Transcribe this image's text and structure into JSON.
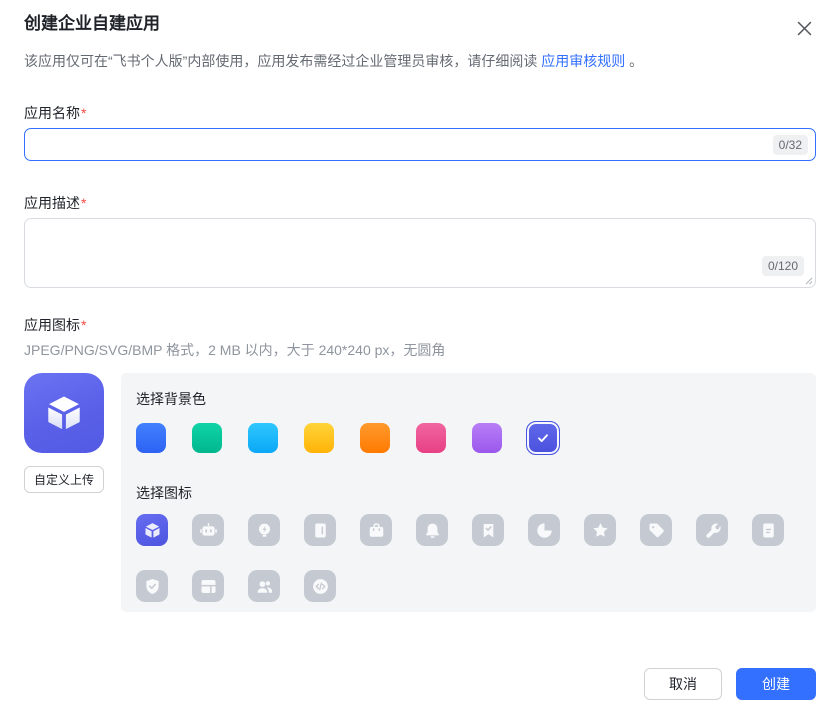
{
  "dialog": {
    "title": "创建企业自建应用",
    "subtitle_prefix": "该应用仅可在“飞书个人版”内部使用，应用发布需经过企业管理员审核，请仔细阅读",
    "subtitle_link": "应用审核规则",
    "subtitle_suffix": "。"
  },
  "fields": {
    "name": {
      "label": "应用名称",
      "required_mark": "*",
      "value": "",
      "placeholder": "",
      "counter": "0/32"
    },
    "description": {
      "label": "应用描述",
      "required_mark": "*",
      "value": "",
      "placeholder": "",
      "counter": "0/120"
    },
    "icon": {
      "label": "应用图标",
      "required_mark": "*",
      "hint": "JPEG/PNG/SVG/BMP 格式，2 MB 以内，大于 240*240 px，无圆角"
    }
  },
  "icon_section": {
    "upload_button": "自定义上传",
    "bg_color_title": "选择背景色",
    "icon_picker_title": "选择图标",
    "selected_icon": "cube",
    "colors": [
      {
        "name": "blue",
        "from": "#4181ff",
        "to": "#2d62f3",
        "selected": false
      },
      {
        "name": "teal",
        "from": "#11d3a7",
        "to": "#00b78e",
        "selected": false
      },
      {
        "name": "sky",
        "from": "#2fc7fe",
        "to": "#0aa8f7",
        "selected": false
      },
      {
        "name": "amber",
        "from": "#ffd43a",
        "to": "#ffb307",
        "selected": false
      },
      {
        "name": "orange",
        "from": "#ff9a2e",
        "to": "#ff7a00",
        "selected": false
      },
      {
        "name": "rose",
        "from": "#f1659f",
        "to": "#e74084",
        "selected": false
      },
      {
        "name": "violet",
        "from": "#b77ef7",
        "to": "#9b58ec",
        "selected": false
      },
      {
        "name": "indigo",
        "from": "#6169ea",
        "to": "#4a50dd",
        "selected": true
      }
    ],
    "icons": [
      {
        "name": "cube",
        "selected": true
      },
      {
        "name": "robot",
        "selected": false
      },
      {
        "name": "bulb",
        "selected": false
      },
      {
        "name": "book",
        "selected": false
      },
      {
        "name": "briefcase",
        "selected": false
      },
      {
        "name": "bell",
        "selected": false
      },
      {
        "name": "bookmark",
        "selected": false
      },
      {
        "name": "pie",
        "selected": false
      },
      {
        "name": "star",
        "selected": false
      },
      {
        "name": "tag",
        "selected": false
      },
      {
        "name": "wrench",
        "selected": false
      },
      {
        "name": "document",
        "selected": false
      },
      {
        "name": "shield",
        "selected": false
      },
      {
        "name": "layout",
        "selected": false
      },
      {
        "name": "people",
        "selected": false
      },
      {
        "name": "code",
        "selected": false
      }
    ]
  },
  "footer": {
    "cancel_label": "取消",
    "create_label": "创建"
  },
  "colors": {
    "accent": "#3370ff",
    "link": "#3370ff",
    "required": "#f54a45",
    "panel_bg": "#f4f5f6",
    "tile_gray": "#c5cad2",
    "selected_tile": "#5a61e8"
  }
}
